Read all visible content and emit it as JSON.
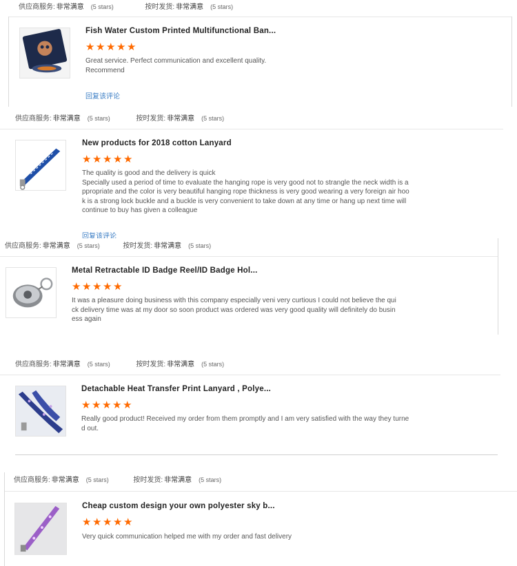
{
  "reviews": [
    {
      "rating": {
        "supplier_label": "供应商服务:",
        "supplier_value": "非常满意",
        "supplier_stars": "(5 stars)",
        "ontime_label": "按时发货:",
        "ontime_value": "非常满意",
        "ontime_stars": "(5 stars)"
      },
      "product_title": "Fish Water Custom Printed Multifunctional Ban...",
      "stars": 5,
      "text_lines": [
        "Great service. Perfect communication and excellent quality.",
        "Recommend"
      ],
      "reply_label": "回复该评论",
      "thumb_icon": "bandana-image"
    },
    {
      "rating": {
        "supplier_label": "供应商服务:",
        "supplier_value": "非常满意",
        "supplier_stars": "(5 stars)",
        "ontime_label": "按时发货:",
        "ontime_value": "非常满意",
        "ontime_stars": "(5 stars)"
      },
      "product_title": "New products for 2018 cotton Lanyard",
      "stars": 5,
      "text_lines": [
        "The quality is good and the delivery is quick",
        "Specially used a period of time to evaluate the hanging rope is very good not to strangle the neck width is a",
        "ppropriate and the color is very beautiful hanging rope thickness is very good wearing a very foreign air hoo",
        "k is a strong lock buckle and a buckle is very convenient to take down at any time or hang up next time will",
        "continue to buy has given a colleague"
      ],
      "reply_label": "回复该评论",
      "thumb_icon": "blue-lanyard-image"
    },
    {
      "rating": {
        "supplier_label": "供应商服务:",
        "supplier_value": "非常满意",
        "supplier_stars": "(5 stars)",
        "ontime_label": "按时发货:",
        "ontime_value": "非常满意",
        "ontime_stars": "(5 stars)"
      },
      "product_title": "Metal Retractable ID Badge Reel/ID Badge Hol...",
      "stars": 5,
      "text_lines": [
        "It was a pleasure doing business with this company especially veni very curtious I could not believe the qui",
        "ck delivery time was at my door so soon product was ordered was very good quality will definitely do busin",
        "ess again"
      ],
      "reply_label": "",
      "thumb_icon": "badge-reel-image"
    },
    {
      "rating": {
        "supplier_label": "供应商服务:",
        "supplier_value": "非常满意",
        "supplier_stars": "(5 stars)",
        "ontime_label": "按时发货:",
        "ontime_value": "非常满意",
        "ontime_stars": "(5 stars)"
      },
      "product_title": "Detachable Heat Transfer Print Lanyard , Polye...",
      "stars": 5,
      "text_lines": [
        "Really good product! Received my order from them promptly and I am very satisfied with the way they turne",
        "d out."
      ],
      "reply_label": "",
      "thumb_icon": "printed-lanyard-image"
    },
    {
      "rating": {
        "supplier_label": "供应商服务:",
        "supplier_value": "非常满意",
        "supplier_stars": "(5 stars)",
        "ontime_label": "按时发货:",
        "ontime_value": "非常满意",
        "ontime_stars": "(5 stars)"
      },
      "product_title": "Cheap custom design your own polyester sky b...",
      "stars": 5,
      "text_lines": [
        "Very quick communication helped me with my order and fast delivery"
      ],
      "reply_label": "",
      "thumb_icon": "purple-lanyard-image"
    }
  ],
  "colors": {
    "star": "#ff6a00",
    "reply_link": "#3a7dc4"
  }
}
